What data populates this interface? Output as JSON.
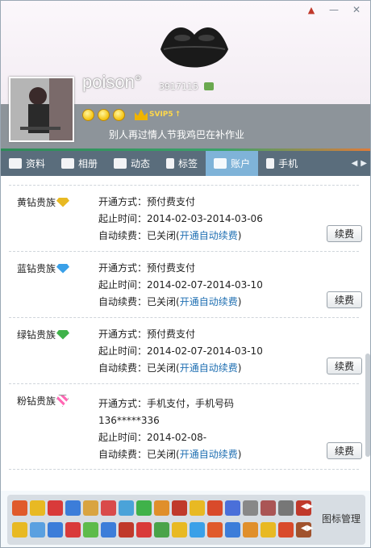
{
  "window": {
    "controls": [
      "pin-icon",
      "minimize-icon",
      "close-icon"
    ]
  },
  "profile": {
    "nickname": "poison°",
    "qq_number": "3917115",
    "signature": "别人再过情人节我鸡巴在补作业",
    "svip_label": "SVIP5"
  },
  "tabs": [
    {
      "label": "资料",
      "icon": "profile-card-icon"
    },
    {
      "label": "相册",
      "icon": "photo-album-icon"
    },
    {
      "label": "动态",
      "icon": "feed-list-icon"
    },
    {
      "label": "标签",
      "icon": "bookmark-icon"
    },
    {
      "label": "账户",
      "icon": "briefcase-icon",
      "active": true
    },
    {
      "label": "手机",
      "icon": "phone-icon"
    }
  ],
  "accounts": [
    {
      "name": "黄钻贵族",
      "badge": "yellow-diamond-icon",
      "method_label": "开通方式：",
      "method": "预付费支付",
      "method_extra": "",
      "period_label": "起止时间：",
      "period": "2014-02-03-2014-03-06",
      "autorenew_label": "自动续费：",
      "autorenew_status": "已关闭",
      "autorenew_link": "开通自动续费",
      "renew_button": "续费"
    },
    {
      "name": "蓝钻贵族",
      "badge": "blue-diamond-icon",
      "method_label": "开通方式：",
      "method": "预付费支付",
      "method_extra": "",
      "period_label": "起止时间：",
      "period": "2014-02-07-2014-03-10",
      "autorenew_label": "自动续费：",
      "autorenew_status": "已关闭",
      "autorenew_link": "开通自动续费",
      "renew_button": "续费"
    },
    {
      "name": "绿钻贵族",
      "badge": "green-diamond-icon",
      "method_label": "开通方式：",
      "method": "预付费支付",
      "method_extra": "",
      "period_label": "起止时间：",
      "period": "2014-02-07-2014-03-10",
      "autorenew_label": "自动续费：",
      "autorenew_status": "已关闭",
      "autorenew_link": "开通自动续费",
      "renew_button": "续费"
    },
    {
      "name": "粉钻贵族",
      "badge": "pink-diamond-icon",
      "method_label": "开通方式：",
      "method": "手机支付，手机号码",
      "method_extra": "136*****336",
      "period_label": "起止时间：",
      "period": "2014-02-08-",
      "autorenew_label": "自动续费：",
      "autorenew_status": "已关闭",
      "autorenew_link": "开通自动续费",
      "renew_button": "续费"
    }
  ],
  "iconbar": {
    "manage_label": "图标管理",
    "row1_colors": [
      "#e05a2b",
      "#e8b923",
      "#d93a3a",
      "#3c7dd9",
      "#d9a441",
      "#d94a4a",
      "#4aa3d9",
      "#3fb24a",
      "#e08f2b",
      "#c0392b",
      "#e8b923",
      "#d94a2b",
      "#4a6fd9",
      "#888888",
      "#a55",
      "#777777",
      "#c0392b"
    ],
    "row2_colors": [
      "#e8b923",
      "#5aa0e0",
      "#3c7dd9",
      "#d93a3a",
      "#5dbb4a",
      "#3c7dd9",
      "#c0392b",
      "#d93a3a",
      "#4aa34a",
      "#e8b923",
      "#3aa0e8",
      "#e05a2b",
      "#3c7dd9",
      "#e08f2b",
      "#e8b923",
      "#d94a2b",
      "#a0522d"
    ]
  }
}
